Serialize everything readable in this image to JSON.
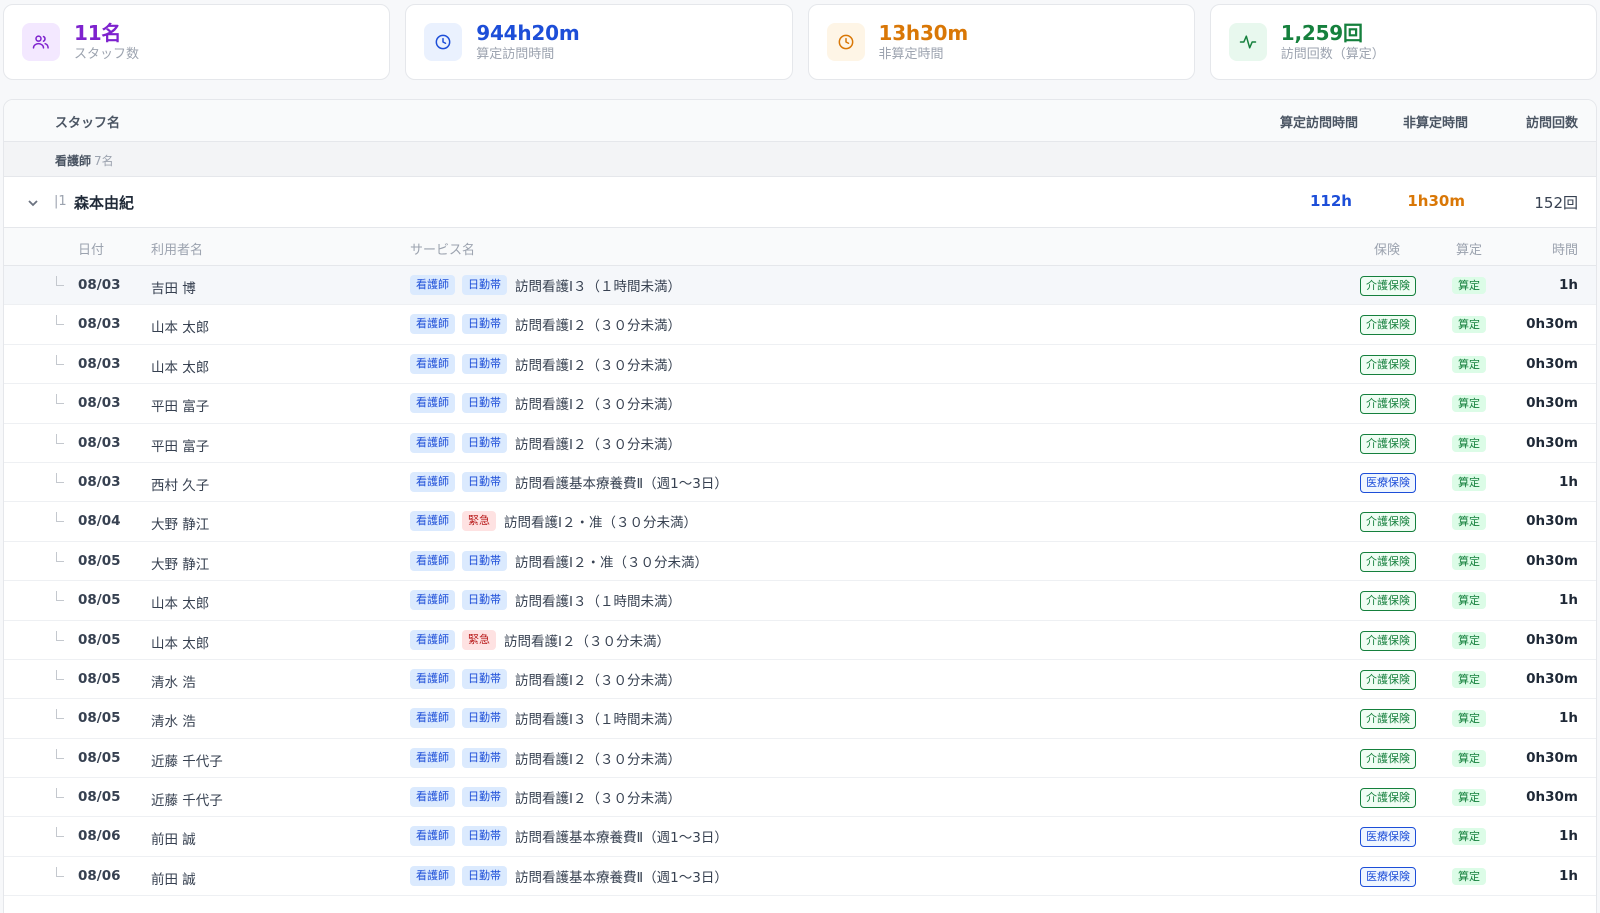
{
  "stats": [
    {
      "value": "11名",
      "label": "スタッフ数",
      "icon": "users-icon",
      "color": "#7e22ce",
      "bg": "#f3e8ff"
    },
    {
      "value": "944h20m",
      "label": "算定訪問時間",
      "icon": "clock-icon",
      "color": "#1d4ed8",
      "bg": "#eaf1fe"
    },
    {
      "value": "13h30m",
      "label": "非算定時間",
      "icon": "clock-icon",
      "color": "#d97706",
      "bg": "#fef5e6"
    },
    {
      "value": "1,259回",
      "label": "訪問回数（算定）",
      "icon": "activity-icon",
      "color": "#15803d",
      "bg": "#e8f8ee"
    }
  ],
  "table_header": {
    "staff": "スタッフ名",
    "billable": "算定訪問時間",
    "non_billable": "非算定時間",
    "visits": "訪問回数"
  },
  "group": {
    "name": "看護師",
    "count": "7名"
  },
  "staff": {
    "name": "森本由紀",
    "billable": "112h",
    "non_billable": "1h30m",
    "visits": "152回",
    "pipe": "|1"
  },
  "detail_header": {
    "date": "日付",
    "patient": "利用者名",
    "service": "サービス名",
    "insurance": "保険",
    "calc": "算定",
    "time": "時間"
  },
  "rows": [
    {
      "date": "08/03",
      "patient": "吉田 博",
      "tags": [
        {
          "t": "看護師",
          "k": "nurse"
        },
        {
          "t": "日勤帯",
          "k": "day"
        }
      ],
      "service": "訪問看護Ⅰ３（１時間未満）",
      "insurance": "介護保険",
      "ins_kind": "care",
      "calc": "算定",
      "time": "1h"
    },
    {
      "date": "08/03",
      "patient": "山本 太郎",
      "tags": [
        {
          "t": "看護師",
          "k": "nurse"
        },
        {
          "t": "日勤帯",
          "k": "day"
        }
      ],
      "service": "訪問看護Ⅰ２（３０分未満）",
      "insurance": "介護保険",
      "ins_kind": "care",
      "calc": "算定",
      "time": "0h30m"
    },
    {
      "date": "08/03",
      "patient": "山本 太郎",
      "tags": [
        {
          "t": "看護師",
          "k": "nurse"
        },
        {
          "t": "日勤帯",
          "k": "day"
        }
      ],
      "service": "訪問看護Ⅰ２（３０分未満）",
      "insurance": "介護保険",
      "ins_kind": "care",
      "calc": "算定",
      "time": "0h30m"
    },
    {
      "date": "08/03",
      "patient": "平田 富子",
      "tags": [
        {
          "t": "看護師",
          "k": "nurse"
        },
        {
          "t": "日勤帯",
          "k": "day"
        }
      ],
      "service": "訪問看護Ⅰ２（３０分未満）",
      "insurance": "介護保険",
      "ins_kind": "care",
      "calc": "算定",
      "time": "0h30m"
    },
    {
      "date": "08/03",
      "patient": "平田 富子",
      "tags": [
        {
          "t": "看護師",
          "k": "nurse"
        },
        {
          "t": "日勤帯",
          "k": "day"
        }
      ],
      "service": "訪問看護Ⅰ２（３０分未満）",
      "insurance": "介護保険",
      "ins_kind": "care",
      "calc": "算定",
      "time": "0h30m"
    },
    {
      "date": "08/03",
      "patient": "西村 久子",
      "tags": [
        {
          "t": "看護師",
          "k": "nurse"
        },
        {
          "t": "日勤帯",
          "k": "day"
        }
      ],
      "service": "訪問看護基本療養費Ⅱ（週1〜3日）",
      "insurance": "医療保険",
      "ins_kind": "med",
      "calc": "算定",
      "time": "1h"
    },
    {
      "date": "08/04",
      "patient": "大野 静江",
      "tags": [
        {
          "t": "看護師",
          "k": "nurse"
        },
        {
          "t": "緊急",
          "k": "emg"
        }
      ],
      "service": "訪問看護Ⅰ２・准（３０分未満）",
      "insurance": "介護保険",
      "ins_kind": "care",
      "calc": "算定",
      "time": "0h30m"
    },
    {
      "date": "08/05",
      "patient": "大野 静江",
      "tags": [
        {
          "t": "看護師",
          "k": "nurse"
        },
        {
          "t": "日勤帯",
          "k": "day"
        }
      ],
      "service": "訪問看護Ⅰ２・准（３０分未満）",
      "insurance": "介護保険",
      "ins_kind": "care",
      "calc": "算定",
      "time": "0h30m"
    },
    {
      "date": "08/05",
      "patient": "山本 太郎",
      "tags": [
        {
          "t": "看護師",
          "k": "nurse"
        },
        {
          "t": "日勤帯",
          "k": "day"
        }
      ],
      "service": "訪問看護Ⅰ３（１時間未満）",
      "insurance": "介護保険",
      "ins_kind": "care",
      "calc": "算定",
      "time": "1h"
    },
    {
      "date": "08/05",
      "patient": "山本 太郎",
      "tags": [
        {
          "t": "看護師",
          "k": "nurse"
        },
        {
          "t": "緊急",
          "k": "emg"
        }
      ],
      "service": "訪問看護Ⅰ２（３０分未満）",
      "insurance": "介護保険",
      "ins_kind": "care",
      "calc": "算定",
      "time": "0h30m"
    },
    {
      "date": "08/05",
      "patient": "清水 浩",
      "tags": [
        {
          "t": "看護師",
          "k": "nurse"
        },
        {
          "t": "日勤帯",
          "k": "day"
        }
      ],
      "service": "訪問看護Ⅰ２（３０分未満）",
      "insurance": "介護保険",
      "ins_kind": "care",
      "calc": "算定",
      "time": "0h30m"
    },
    {
      "date": "08/05",
      "patient": "清水 浩",
      "tags": [
        {
          "t": "看護師",
          "k": "nurse"
        },
        {
          "t": "日勤帯",
          "k": "day"
        }
      ],
      "service": "訪問看護Ⅰ３（１時間未満）",
      "insurance": "介護保険",
      "ins_kind": "care",
      "calc": "算定",
      "time": "1h"
    },
    {
      "date": "08/05",
      "patient": "近藤 千代子",
      "tags": [
        {
          "t": "看護師",
          "k": "nurse"
        },
        {
          "t": "日勤帯",
          "k": "day"
        }
      ],
      "service": "訪問看護Ⅰ２（３０分未満）",
      "insurance": "介護保険",
      "ins_kind": "care",
      "calc": "算定",
      "time": "0h30m"
    },
    {
      "date": "08/05",
      "patient": "近藤 千代子",
      "tags": [
        {
          "t": "看護師",
          "k": "nurse"
        },
        {
          "t": "日勤帯",
          "k": "day"
        }
      ],
      "service": "訪問看護Ⅰ２（３０分未満）",
      "insurance": "介護保険",
      "ins_kind": "care",
      "calc": "算定",
      "time": "0h30m"
    },
    {
      "date": "08/06",
      "patient": "前田 誠",
      "tags": [
        {
          "t": "看護師",
          "k": "nurse"
        },
        {
          "t": "日勤帯",
          "k": "day"
        }
      ],
      "service": "訪問看護基本療養費Ⅱ（週1〜3日）",
      "insurance": "医療保険",
      "ins_kind": "med",
      "calc": "算定",
      "time": "1h"
    },
    {
      "date": "08/06",
      "patient": "前田 誠",
      "tags": [
        {
          "t": "看護師",
          "k": "nurse"
        },
        {
          "t": "日勤帯",
          "k": "day"
        }
      ],
      "service": "訪問看護基本療養費Ⅱ（週1〜3日）",
      "insurance": "医療保険",
      "ins_kind": "med",
      "calc": "算定",
      "time": "1h"
    }
  ]
}
